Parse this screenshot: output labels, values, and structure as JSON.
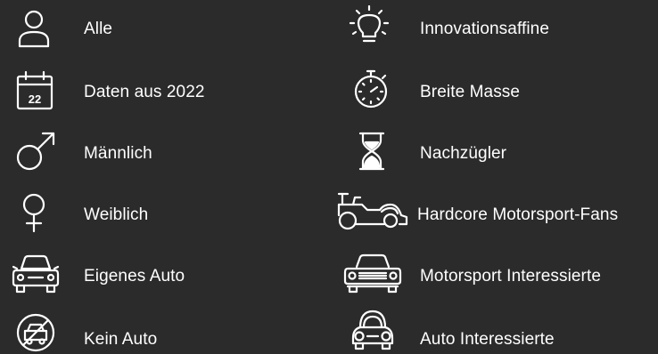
{
  "colors": {
    "background": "#2b2b2b",
    "foreground": "#ffffff"
  },
  "legend": {
    "left": [
      {
        "label": "Alle",
        "icon": "person-icon"
      },
      {
        "label": "Daten aus 2022",
        "icon": "calendar-icon",
        "icon_text": "22"
      },
      {
        "label": "Männlich",
        "icon": "male-symbol-icon"
      },
      {
        "label": "Weiblich",
        "icon": "female-symbol-icon"
      },
      {
        "label": "Eigenes Auto",
        "icon": "car-front-icon"
      },
      {
        "label": "Kein Auto",
        "icon": "no-car-icon"
      }
    ],
    "right": [
      {
        "label": "Innovationsaffine",
        "icon": "lightbulb-icon"
      },
      {
        "label": "Breite Masse",
        "icon": "stopwatch-icon"
      },
      {
        "label": "Nachzügler",
        "icon": "hourglass-icon"
      },
      {
        "label": "Hardcore Motorsport-Fans",
        "icon": "race-car-icon"
      },
      {
        "label": "Motorsport Interessierte",
        "icon": "muscle-car-icon"
      },
      {
        "label": "Auto Interessierte",
        "icon": "beetle-car-icon"
      }
    ]
  }
}
